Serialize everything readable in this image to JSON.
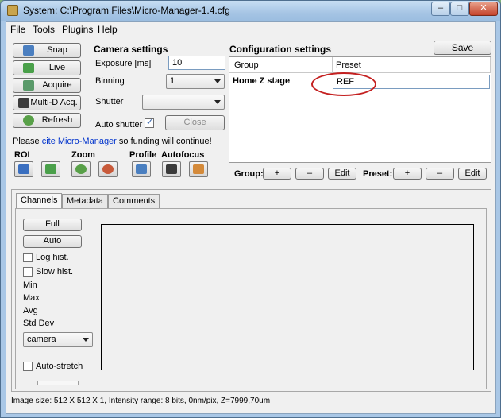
{
  "window": {
    "title": "System: C:\\Program Files\\Micro-Manager-1.4.cfg",
    "controls": {
      "minimize": "–",
      "maximize": "□",
      "close": "✕"
    }
  },
  "menu": [
    "File",
    "Tools",
    "Plugins",
    "Help"
  ],
  "left_buttons": [
    {
      "label": "Snap",
      "icon": "camera-icon"
    },
    {
      "label": "Live",
      "icon": "live-video-icon"
    },
    {
      "label": "Acquire",
      "icon": "acquire-icon"
    },
    {
      "label": "Multi-D Acq.",
      "icon": "multi-d-icon"
    },
    {
      "label": "Refresh",
      "icon": "refresh-icon"
    }
  ],
  "camera": {
    "section_title": "Camera settings",
    "exposure_label": "Exposure [ms]",
    "exposure_value": "10",
    "binning_label": "Binning",
    "binning_value": "1",
    "shutter_label": "Shutter",
    "shutter_value": "",
    "auto_shutter_label": "Auto shutter",
    "auto_shutter_checked": true,
    "close_label": "Close"
  },
  "cite": {
    "before": "Please ",
    "link": "cite Micro-Manager",
    "after": " so funding will continue!"
  },
  "tools": {
    "roi_label": "ROI",
    "zoom_label": "Zoom",
    "profile_label": "Profile",
    "autofocus_label": "Autofocus"
  },
  "config": {
    "section_title": "Configuration settings",
    "save_label": "Save",
    "col_group": "Group",
    "col_preset": "Preset",
    "rows": [
      {
        "group": "Home Z stage",
        "preset": "REF"
      }
    ],
    "group_label": "Group:",
    "preset_label": "Preset:",
    "add": "+",
    "remove": "–",
    "edit": "Edit"
  },
  "tabs": [
    "Channels",
    "Metadata",
    "Comments"
  ],
  "channels": {
    "full_label": "Full",
    "auto_label": "Auto",
    "log_hist_label": "Log hist.",
    "slow_hist_label": "Slow hist.",
    "stats": [
      "Min",
      "Max",
      "Avg",
      "Std Dev"
    ],
    "channel_select": "camera",
    "auto_stretch_label": "Auto-stretch"
  },
  "status_bar": "Image size: 512 X 512 X 1, Intensity range: 8 bits, 0nm/pix, Z=7999,70um",
  "colors": {
    "link": "#0033cc",
    "annotation": "#c42020",
    "titlebar": "#a9c7e6"
  }
}
